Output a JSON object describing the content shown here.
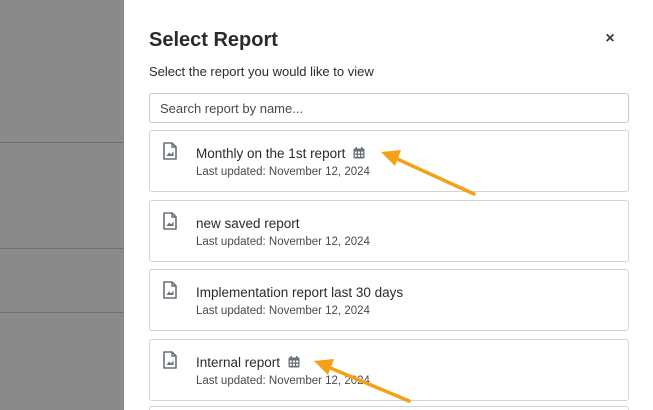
{
  "modal": {
    "title": "Select Report",
    "close_label": "×",
    "subtitle": "Select the report you would like to view",
    "search_placeholder": "Search report by name..."
  },
  "reports": [
    {
      "name": "Monthly on the 1st report",
      "updated": "Last updated: November 12, 2024",
      "scheduled": true
    },
    {
      "name": "new saved report",
      "updated": "Last updated: November 12, 2024",
      "scheduled": false
    },
    {
      "name": "Implementation report last 30 days",
      "updated": "Last updated: November 12, 2024",
      "scheduled": false
    },
    {
      "name": "Internal report",
      "updated": "Last updated: November 12, 2024",
      "scheduled": true
    }
  ],
  "icons": {
    "report": "report-file-icon",
    "schedule": "calendar-icon",
    "annotation": "orange-arrow-annotation"
  },
  "colors": {
    "arrow": "#f5a018",
    "icon": "#6a7078",
    "backdrop": "#8a8a8a"
  }
}
